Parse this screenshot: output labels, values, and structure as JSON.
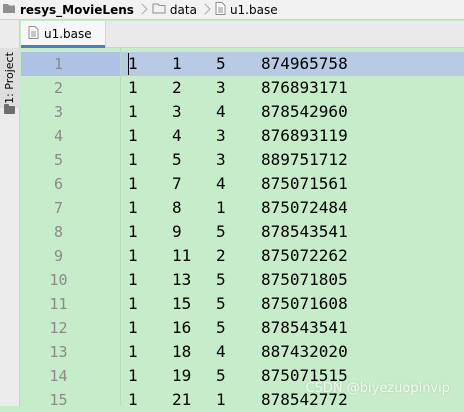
{
  "breadcrumb": {
    "items": [
      {
        "label": "resys_MovieLens",
        "icon": "folder-icon"
      },
      {
        "label": "data",
        "icon": "folder-icon"
      },
      {
        "label": "u1.base",
        "icon": "text-file-icon"
      }
    ]
  },
  "sidebar": {
    "project_tab_label": "1: Project"
  },
  "editor": {
    "tab_label": "u1.base",
    "current_line": 1,
    "rows": [
      {
        "line": "1",
        "user": "1",
        "item": "1",
        "rating": "5",
        "timestamp": "874965758"
      },
      {
        "line": "2",
        "user": "1",
        "item": "2",
        "rating": "3",
        "timestamp": "876893171"
      },
      {
        "line": "3",
        "user": "1",
        "item": "3",
        "rating": "4",
        "timestamp": "878542960"
      },
      {
        "line": "4",
        "user": "1",
        "item": "4",
        "rating": "3",
        "timestamp": "876893119"
      },
      {
        "line": "5",
        "user": "1",
        "item": "5",
        "rating": "3",
        "timestamp": "889751712"
      },
      {
        "line": "6",
        "user": "1",
        "item": "7",
        "rating": "4",
        "timestamp": "875071561"
      },
      {
        "line": "7",
        "user": "1",
        "item": "8",
        "rating": "1",
        "timestamp": "875072484"
      },
      {
        "line": "8",
        "user": "1",
        "item": "9",
        "rating": "5",
        "timestamp": "878543541"
      },
      {
        "line": "9",
        "user": "1",
        "item": "11",
        "rating": "2",
        "timestamp": "875072262"
      },
      {
        "line": "10",
        "user": "1",
        "item": "13",
        "rating": "5",
        "timestamp": "875071805"
      },
      {
        "line": "11",
        "user": "1",
        "item": "15",
        "rating": "5",
        "timestamp": "875071608"
      },
      {
        "line": "12",
        "user": "1",
        "item": "16",
        "rating": "5",
        "timestamp": "878543541"
      },
      {
        "line": "13",
        "user": "1",
        "item": "18",
        "rating": "4",
        "timestamp": "887432020"
      },
      {
        "line": "14",
        "user": "1",
        "item": "19",
        "rating": "5",
        "timestamp": "875071515"
      },
      {
        "line": "15",
        "user": "1",
        "item": "21",
        "rating": "1",
        "timestamp": "878542772"
      }
    ]
  },
  "watermark": {
    "text": "CSDN @biyezuopinvip"
  },
  "colors": {
    "editor_background": "#c7ecc9",
    "current_line": "#b9cbe4",
    "line_number": "#8a8a8a",
    "tab_accent": "#4083c9"
  }
}
